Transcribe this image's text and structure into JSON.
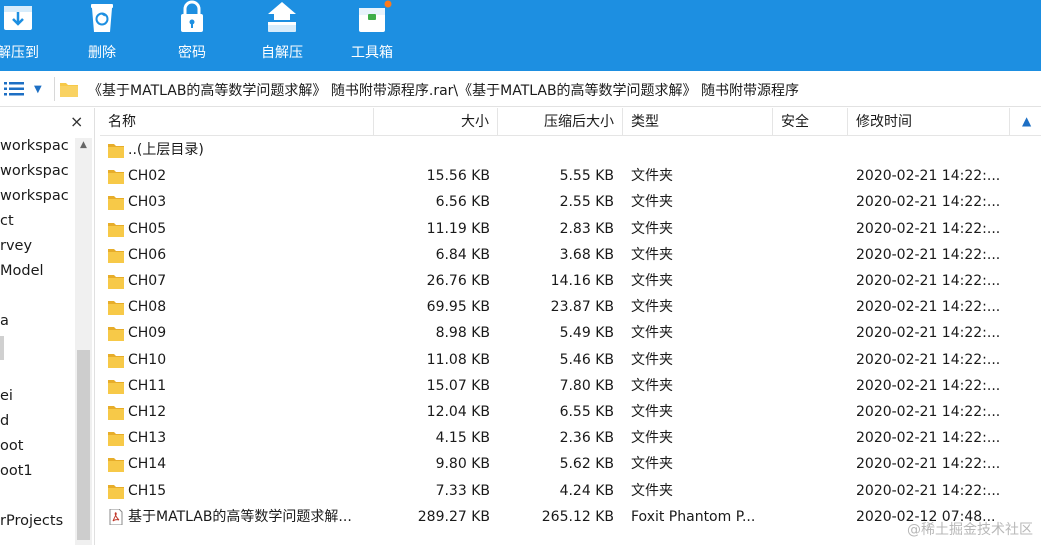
{
  "toolbar": {
    "items": [
      {
        "label": "解压到",
        "icon": "extract-icon"
      },
      {
        "label": "删除",
        "icon": "recycle-bin-icon"
      },
      {
        "label": "密码",
        "icon": "lock-icon"
      },
      {
        "label": "自解压",
        "icon": "self-extract-icon"
      },
      {
        "label": "工具箱",
        "icon": "toolbox-icon"
      }
    ],
    "accent": "#1d8fe1"
  },
  "address": {
    "path": "《基于MATLAB的高等数学问题求解》 随书附带源程序.rar\\《基于MATLAB的高等数学问题求解》 随书附带源程序"
  },
  "tree": {
    "close": "×",
    "items": [
      "workspac",
      "workspac",
      "workspac",
      "ct",
      "rvey",
      "Model",
      "a",
      "ei",
      "d",
      "oot",
      "oot1",
      "rProjects"
    ]
  },
  "columns": {
    "name": "名称",
    "size": "大小",
    "packed": "压缩后大小",
    "type": "类型",
    "security": "安全",
    "modified": "修改时间"
  },
  "rows": [
    {
      "name": "..(上层目录)",
      "size": "",
      "packed": "",
      "type": "",
      "modified": "",
      "icon": "folder"
    },
    {
      "name": "CH02",
      "size": "15.56 KB",
      "packed": "5.55 KB",
      "type": "文件夹",
      "modified": "2020-02-21 14:22:...",
      "icon": "folder"
    },
    {
      "name": "CH03",
      "size": "6.56 KB",
      "packed": "2.55 KB",
      "type": "文件夹",
      "modified": "2020-02-21 14:22:...",
      "icon": "folder"
    },
    {
      "name": "CH05",
      "size": "11.19 KB",
      "packed": "2.83 KB",
      "type": "文件夹",
      "modified": "2020-02-21 14:22:...",
      "icon": "folder"
    },
    {
      "name": "CH06",
      "size": "6.84 KB",
      "packed": "3.68 KB",
      "type": "文件夹",
      "modified": "2020-02-21 14:22:...",
      "icon": "folder"
    },
    {
      "name": "CH07",
      "size": "26.76 KB",
      "packed": "14.16 KB",
      "type": "文件夹",
      "modified": "2020-02-21 14:22:...",
      "icon": "folder"
    },
    {
      "name": "CH08",
      "size": "69.95 KB",
      "packed": "23.87 KB",
      "type": "文件夹",
      "modified": "2020-02-21 14:22:...",
      "icon": "folder"
    },
    {
      "name": "CH09",
      "size": "8.98 KB",
      "packed": "5.49 KB",
      "type": "文件夹",
      "modified": "2020-02-21 14:22:...",
      "icon": "folder"
    },
    {
      "name": "CH10",
      "size": "11.08 KB",
      "packed": "5.46 KB",
      "type": "文件夹",
      "modified": "2020-02-21 14:22:...",
      "icon": "folder"
    },
    {
      "name": "CH11",
      "size": "15.07 KB",
      "packed": "7.80 KB",
      "type": "文件夹",
      "modified": "2020-02-21 14:22:...",
      "icon": "folder"
    },
    {
      "name": "CH12",
      "size": "12.04 KB",
      "packed": "6.55 KB",
      "type": "文件夹",
      "modified": "2020-02-21 14:22:...",
      "icon": "folder"
    },
    {
      "name": "CH13",
      "size": "4.15 KB",
      "packed": "2.36 KB",
      "type": "文件夹",
      "modified": "2020-02-21 14:22:...",
      "icon": "folder"
    },
    {
      "name": "CH14",
      "size": "9.80 KB",
      "packed": "5.62 KB",
      "type": "文件夹",
      "modified": "2020-02-21 14:22:...",
      "icon": "folder"
    },
    {
      "name": "CH15",
      "size": "7.33 KB",
      "packed": "4.24 KB",
      "type": "文件夹",
      "modified": "2020-02-21 14:22:...",
      "icon": "folder"
    },
    {
      "name": "基于MATLAB的高等数学问题求解...",
      "size": "289.27 KB",
      "packed": "265.12 KB",
      "type": "Foxit Phantom P...",
      "modified": "2020-02-12 07:48...",
      "icon": "pdf"
    }
  ],
  "watermark": "@稀土掘金技术社区",
  "colors": {
    "folder": "#f7c948",
    "folder_dark": "#e7ad2a",
    "pdf_red": "#c0392b"
  }
}
